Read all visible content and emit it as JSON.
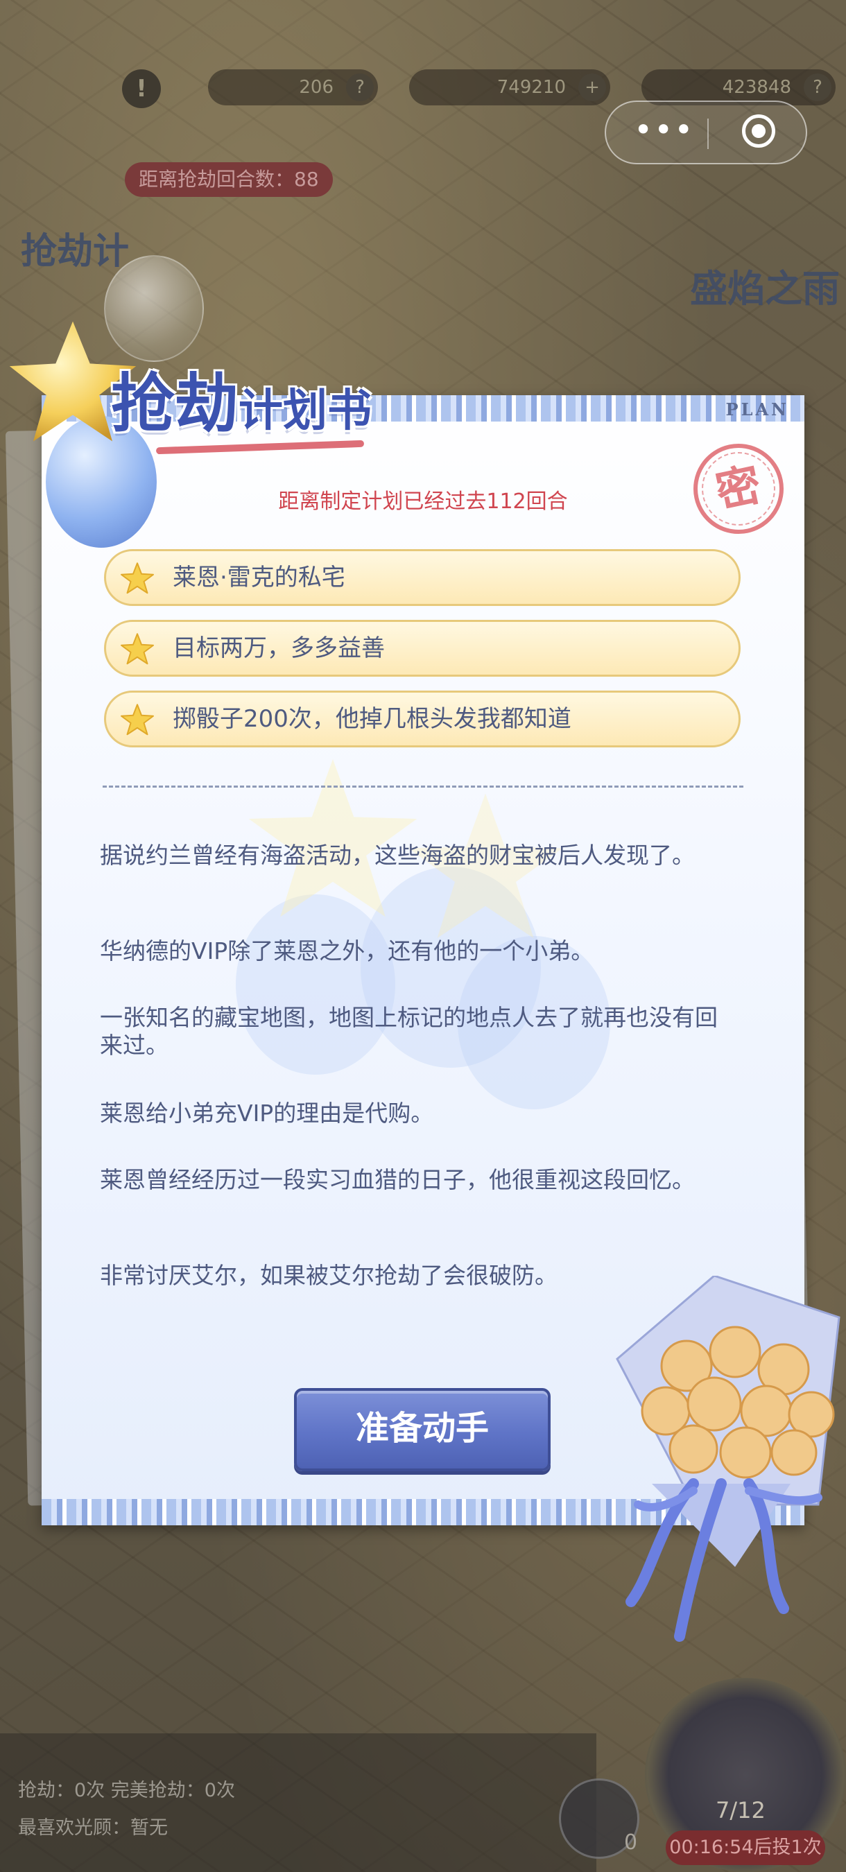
{
  "topbar": {
    "resource_1": "206",
    "resource_2": "749210",
    "resource_3": "423848",
    "help_glyph": "?",
    "plus_glyph": "+",
    "alert_glyph": "!"
  },
  "mini_program": {
    "menu_glyph": "•••"
  },
  "background": {
    "round_counter": "距离抢劫回合数：88",
    "left_title": "抢劫计",
    "right_title": "盛焰之雨"
  },
  "card": {
    "title_big": "抢劫",
    "title_small": "计划书",
    "plan_tag": "PLAN",
    "stamp": "密",
    "elapsed": "距离制定计划已经过去112回合",
    "goals": [
      "莱恩·雷克的私宅",
      "目标两万，多多益善",
      "掷骰子200次，他掉几根头发我都知道"
    ],
    "paragraphs": [
      "据说约兰曾经有海盗活动，这些海盗的财宝被后人发现了。",
      "华纳德的VIP除了莱恩之外，还有他的一个小弟。",
      "一张知名的藏宝地图，地图上标记的地点人去了就再也没有回来过。",
      "莱恩给小弟充VIP的理由是代购。",
      "莱恩曾经经历过一段实习血猎的日子，他很重视这段回忆。",
      "非常讨厌艾尔，如果被艾尔抢劫了会很破防。"
    ],
    "action_label": "准备动手"
  },
  "bottom": {
    "stats_line_1": "抢劫：0次  完美抢劫：0次",
    "stats_line_2": "最喜欢光顾：暂无",
    "dice_count": "0",
    "wheel_count": "7/12",
    "timer": "00:16:54后投1次"
  },
  "colors": {
    "title_blue": "#3c53b0",
    "alert_red": "#d0454f",
    "body_text": "#4e5a80",
    "button_blue": "#5f74c7",
    "goal_gold": "#fde9b6"
  }
}
